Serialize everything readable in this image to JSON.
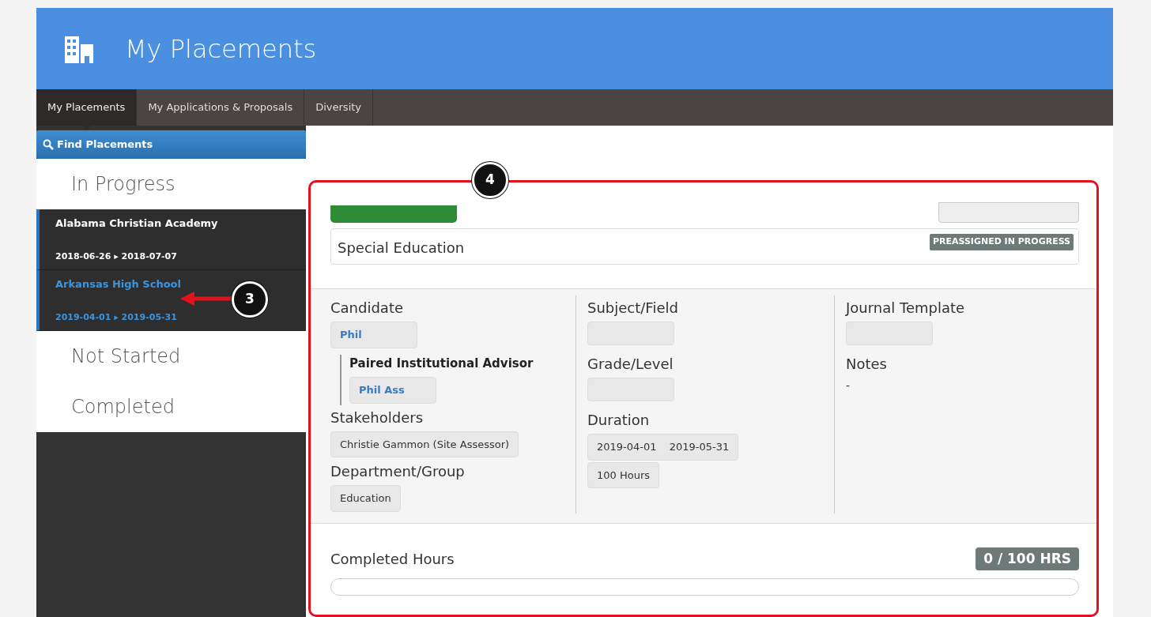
{
  "header": {
    "title": "My Placements"
  },
  "tabs": [
    {
      "label": "My Placements",
      "selected": true
    },
    {
      "label": "My Applications & Proposals",
      "selected": false
    },
    {
      "label": "Diversity",
      "selected": false
    }
  ],
  "find_button": "Find Placements",
  "sidebar": {
    "sections": [
      {
        "label": "In Progress",
        "items": [
          {
            "name": "Alabama Christian Academy",
            "dates": "2018-06-26 ▸ 2018-07-07",
            "selected": false
          },
          {
            "name": "Arkansas High School",
            "dates": "2019-04-01 ▸ 2019-05-31",
            "selected": true
          }
        ]
      },
      {
        "label": "Not Started"
      },
      {
        "label": "Completed"
      }
    ]
  },
  "placement": {
    "title": "Special Education",
    "status": "PREASSIGNED IN PROGRESS",
    "columns": [
      [
        {
          "label": "Candidate",
          "chips": [
            {
              "text": "Phil",
              "kind": "link"
            }
          ],
          "sub": {
            "label": "Paired Institutional Advisor",
            "chips": [
              {
                "text": "Phil Ass",
                "kind": "link"
              }
            ]
          }
        },
        {
          "label": "Stakeholders",
          "chips": [
            {
              "text": "Christie Gammon (Site Assessor)",
              "kind": "plain"
            }
          ]
        },
        {
          "label": "Department/Group",
          "chips": [
            {
              "text": "Education",
              "kind": "plain"
            }
          ]
        }
      ],
      [
        {
          "label": "Subject/Field",
          "chips": [
            {
              "kind": "blank"
            }
          ]
        },
        {
          "label": "Grade/Level",
          "chips": [
            {
              "kind": "blank"
            }
          ]
        },
        {
          "label": "Duration",
          "chips": [
            {
              "text": "2019-04-01",
              "end": "2019-05-31",
              "kind": "range"
            },
            {
              "text": "100 Hours",
              "kind": "plain"
            }
          ]
        }
      ],
      [
        {
          "label": "Journal Template",
          "chips": [
            {
              "kind": "blank"
            }
          ]
        },
        {
          "label": "Notes",
          "value": "-"
        }
      ]
    ]
  },
  "hours": {
    "label": "Completed Hours",
    "badge": "0 / 100 HRS",
    "level": 0
  },
  "callouts": [
    {
      "number": "3"
    },
    {
      "number": "4"
    }
  ]
}
